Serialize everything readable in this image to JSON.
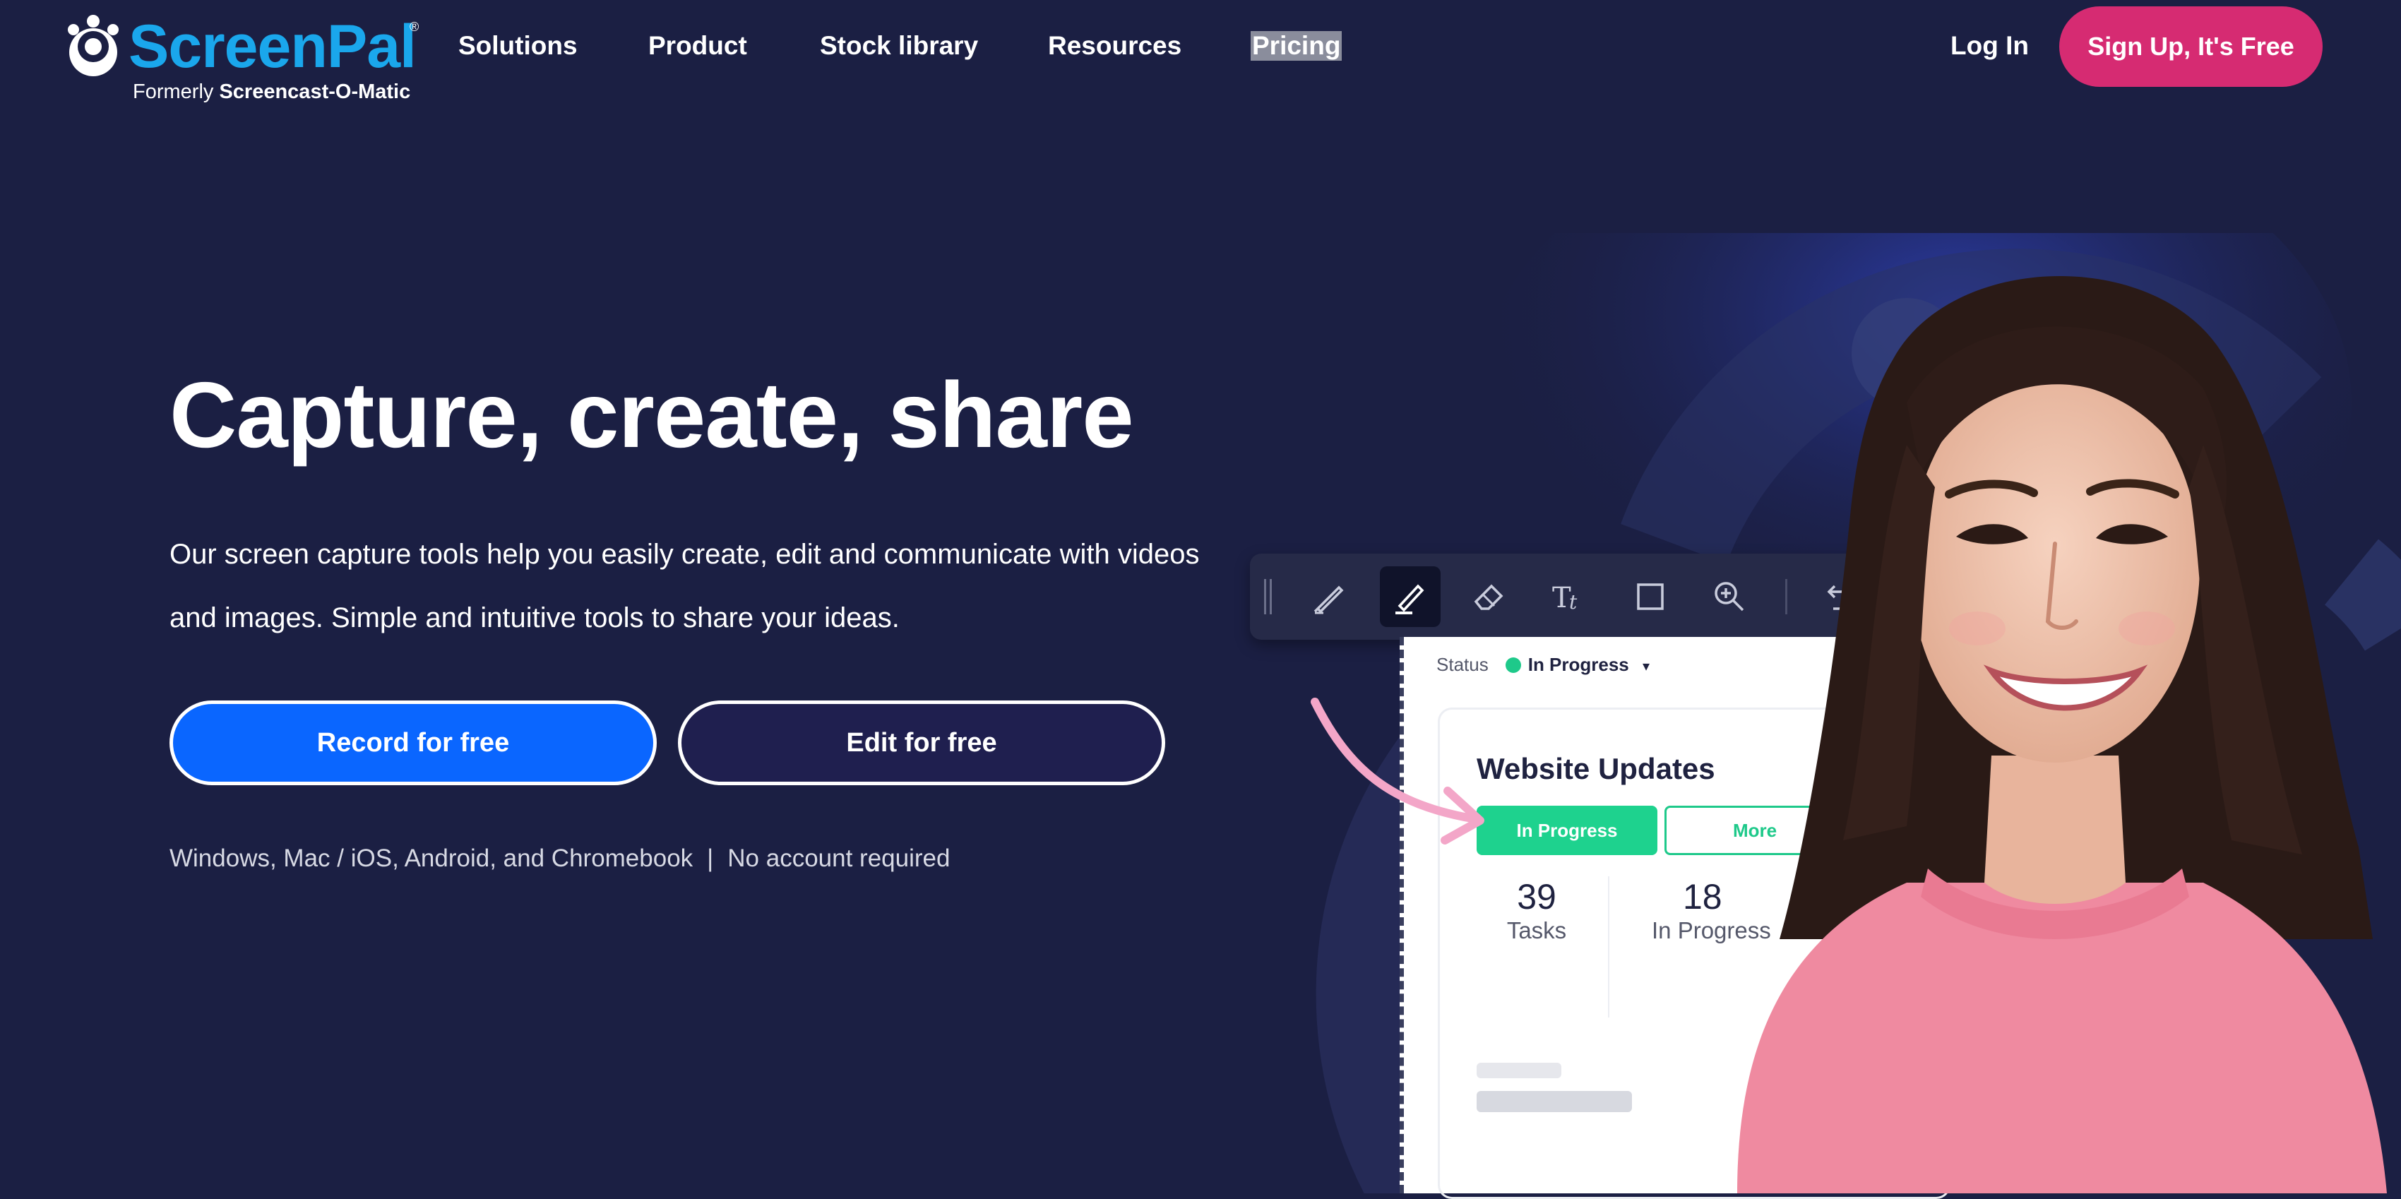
{
  "header": {
    "logo_word": "ScreenPal",
    "logo_reg": "®",
    "logo_formerly": "Formerly",
    "logo_former_name": "Screencast-O-Matic",
    "nav": [
      "Solutions",
      "Product",
      "Stock library",
      "Resources",
      "Pricing"
    ],
    "login_label": "Log In",
    "signup_label": "Sign Up, It's Free"
  },
  "hero": {
    "title": "Capture, create, share",
    "subtitle": "Our screen capture tools help you easily create, edit and communicate with videos and images. Simple and intuitive tools to share your ideas.",
    "record_button": "Record for free",
    "edit_button": "Edit for free",
    "platforms": "Windows, Mac / iOS, Android, and Chromebook",
    "separator": "|",
    "no_account": "No account required"
  },
  "mockup": {
    "status_label": "Status",
    "status_value": "In Progress",
    "status_caret": "▾",
    "card_title": "Website Updates",
    "pill_in_progress": "In Progress",
    "pill_more": "More",
    "stats": [
      {
        "number": "39",
        "label": "Tasks"
      },
      {
        "number": "18",
        "label": "In Progress"
      }
    ],
    "tools": [
      "pen-icon",
      "highlighter-icon",
      "eraser-icon",
      "text-icon",
      "rectangle-icon",
      "zoom-icon",
      "undo-icon",
      "redo-icon"
    ]
  },
  "colors": {
    "background": "#1b1f43",
    "brand_blue": "#1aa7ec",
    "signup_pink": "#d62b72",
    "record_blue": "#0a66ff",
    "edit_navy": "#1f1f4f",
    "progress_green": "#1ed28e"
  }
}
